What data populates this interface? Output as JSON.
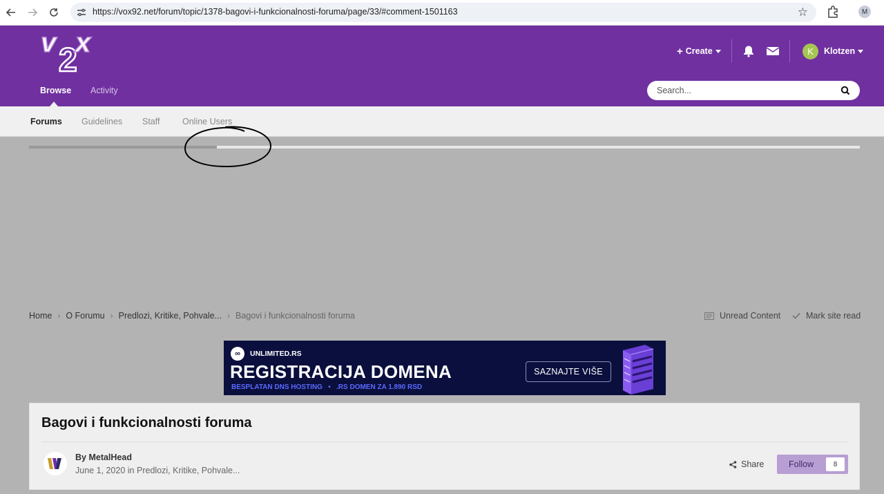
{
  "browser": {
    "url": "https://vox92.net/forum/topic/1378-bagovi-i-funkcionalnosti-foruma/page/33/#comment-1501163",
    "profile_initial": "M"
  },
  "header": {
    "logo_text": "vox",
    "create_label": "Create",
    "username": "Klotzen",
    "avatar_initial": "K",
    "tabs": [
      {
        "label": "Browse"
      },
      {
        "label": "Activity"
      }
    ],
    "search_placeholder": "Search..."
  },
  "subnav": {
    "items": [
      {
        "label": "Forums"
      },
      {
        "label": "Guidelines"
      },
      {
        "label": "Staff"
      },
      {
        "label": "Online Users"
      }
    ]
  },
  "progress": {
    "fraction": 0.226
  },
  "breadcrumb": {
    "items": [
      "Home",
      "O Forumu",
      "Predlozi, Kritike, Pohvale...",
      "Bagovi i funkcionalnosti foruma"
    ],
    "unread_label": "Unread Content",
    "mark_read_label": "Mark site read"
  },
  "ad": {
    "brand": "UNLIMITED.RS",
    "headline": "REGISTRACIJA DOMENA",
    "subline": "BESPLATAN DNS HOSTING   •   .RS DOMEN ZA 1.890 RSD",
    "cta": "SAZNAJTE VIŠE"
  },
  "topic": {
    "title": "Bagovi i funkcionalnosti foruma",
    "author_line": "By MetalHead",
    "date": "June 1, 2020",
    "in_word": "in",
    "category": "Predlozi, Kritike, Pohvale...",
    "share_label": "Share",
    "follow_label": "Follow",
    "follow_count": "8"
  },
  "colors": {
    "header_purple": "#7030a0",
    "follow_button": "#b79ed3",
    "ad_background": "#0b0f3d",
    "avatar_green": "#a7c651"
  }
}
